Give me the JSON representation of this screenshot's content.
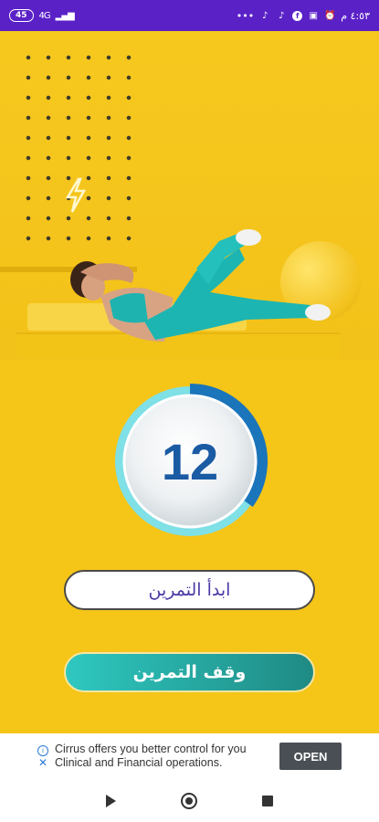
{
  "status_bar": {
    "battery": "45",
    "network": "4G",
    "time": "٤:٥٣ م",
    "overflow": "•••"
  },
  "counter": {
    "value": "12",
    "progress": 0.35
  },
  "buttons": {
    "start_label": "ابدأ التمرين",
    "stop_label": "وقف التمرين"
  },
  "ad": {
    "text": "Cirrus offers you better control for you Clinical and Financial operations.",
    "cta": "OPEN"
  },
  "icons": {
    "status": [
      "alarm-icon",
      "sim-icon",
      "facebook-icon",
      "tiktok-icon",
      "tiktok-icon",
      "more-icon"
    ],
    "nav": [
      "back-icon",
      "home-icon",
      "recents-icon"
    ]
  },
  "colors": {
    "status_bar": "#5a21c7",
    "background": "#f5c518",
    "counter_text": "#1a5ba3",
    "ring_progress": "#1b75bb",
    "ring_track": "#7fe0e6",
    "stop_button": "#2ec8c0",
    "start_button_text": "#4a3aa6"
  }
}
